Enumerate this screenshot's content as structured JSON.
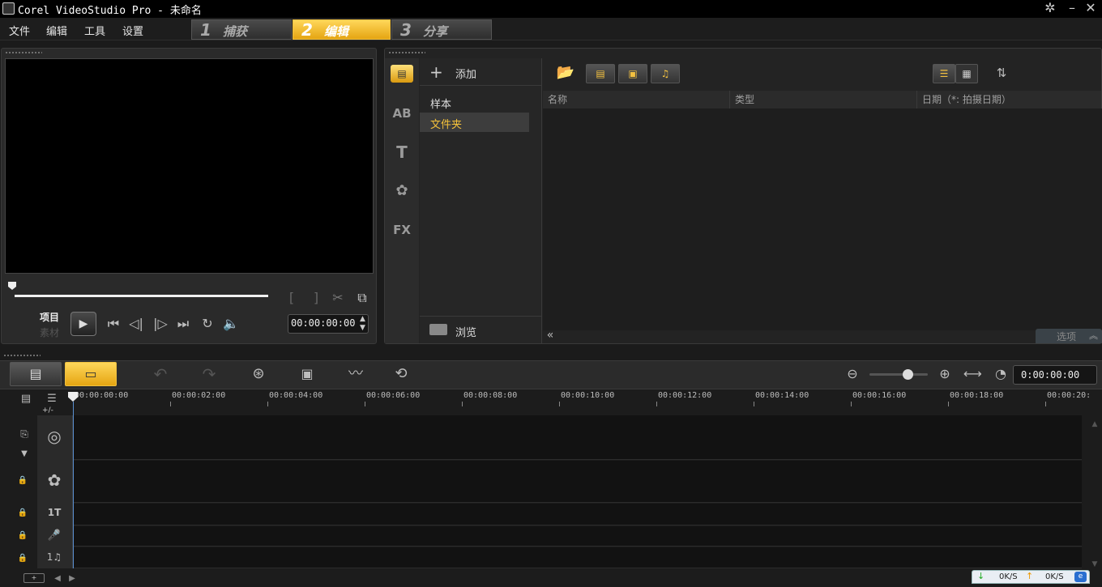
{
  "window": {
    "title": "Corel VideoStudio Pro - 未命名"
  },
  "menu": [
    "文件",
    "编辑",
    "工具",
    "设置"
  ],
  "steps": [
    {
      "num": "1",
      "label": "捕获"
    },
    {
      "num": "2",
      "label": "编辑"
    },
    {
      "num": "3",
      "label": "分享"
    }
  ],
  "preview": {
    "mode_project": "项目",
    "mode_clip": "素材",
    "timecode": "00:00:00:00"
  },
  "library": {
    "add_label": "添加",
    "folders": [
      "样本",
      "文件夹"
    ],
    "browse_label": "浏览",
    "columns": [
      "名称",
      "类型",
      "日期（*: 拍摄日期）"
    ],
    "options_label": "选项",
    "category_icons": [
      "media-icon",
      "transition-icon",
      "title-icon",
      "graphic-icon",
      "filter-fx-icon"
    ]
  },
  "timeline": {
    "timecode": "0:00:00:00",
    "ruler": [
      "00:00:00:00",
      "00:00:02:00",
      "00:00:04:00",
      "00:00:06:00",
      "00:00:08:00",
      "00:00:10:00",
      "00:00:12:00",
      "00:00:14:00",
      "00:00:16:00",
      "00:00:18:00",
      "00:00:20:"
    ],
    "add_track": "+/-",
    "zoom_slider_percent": 65,
    "tracks": [
      "video-track",
      "overlay-track",
      "title-track",
      "voice-track",
      "music-track"
    ],
    "track_labels": [
      "",
      "",
      "1T",
      "",
      "1♫"
    ]
  },
  "statusbar": {
    "down_speed": "0K/S",
    "up_speed": "0K/S"
  },
  "colors": {
    "accent": "#f2b928",
    "selected_folder": "#3d3d3d",
    "active_folder_text": "#f5c23a"
  }
}
